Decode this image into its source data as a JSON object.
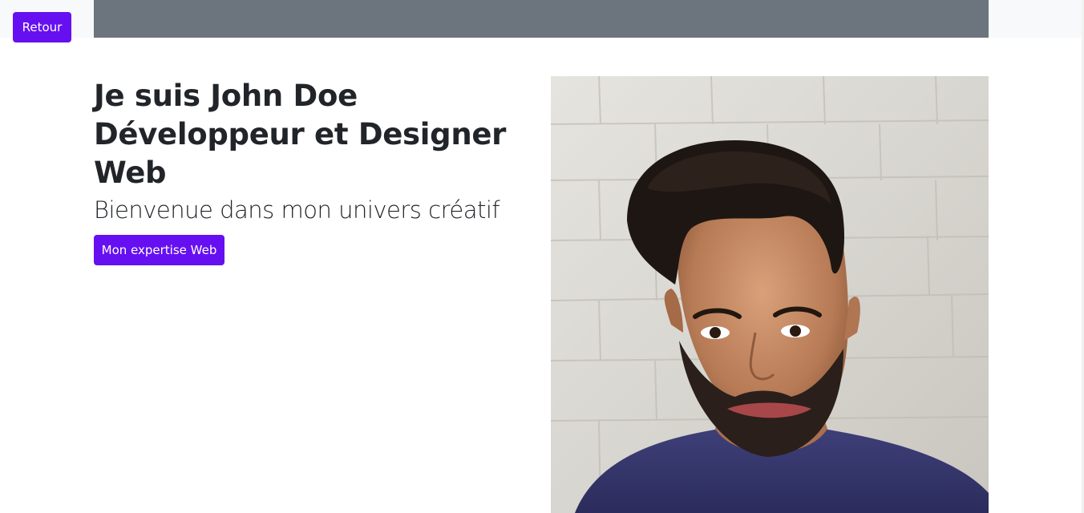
{
  "header": {
    "back_label": "Retour"
  },
  "hero": {
    "title_line1": "Je suis John Doe",
    "title_line2": "Développeur et Designer Web",
    "subtitle": "Bienvenue dans mon univers créatif",
    "cta_label": "Mon expertise Web"
  },
  "colors": {
    "accent": "#6610f2",
    "topbar": "#6c757d",
    "page_bg": "#ffffff"
  },
  "photo": {
    "subject": "portrait-photo"
  }
}
